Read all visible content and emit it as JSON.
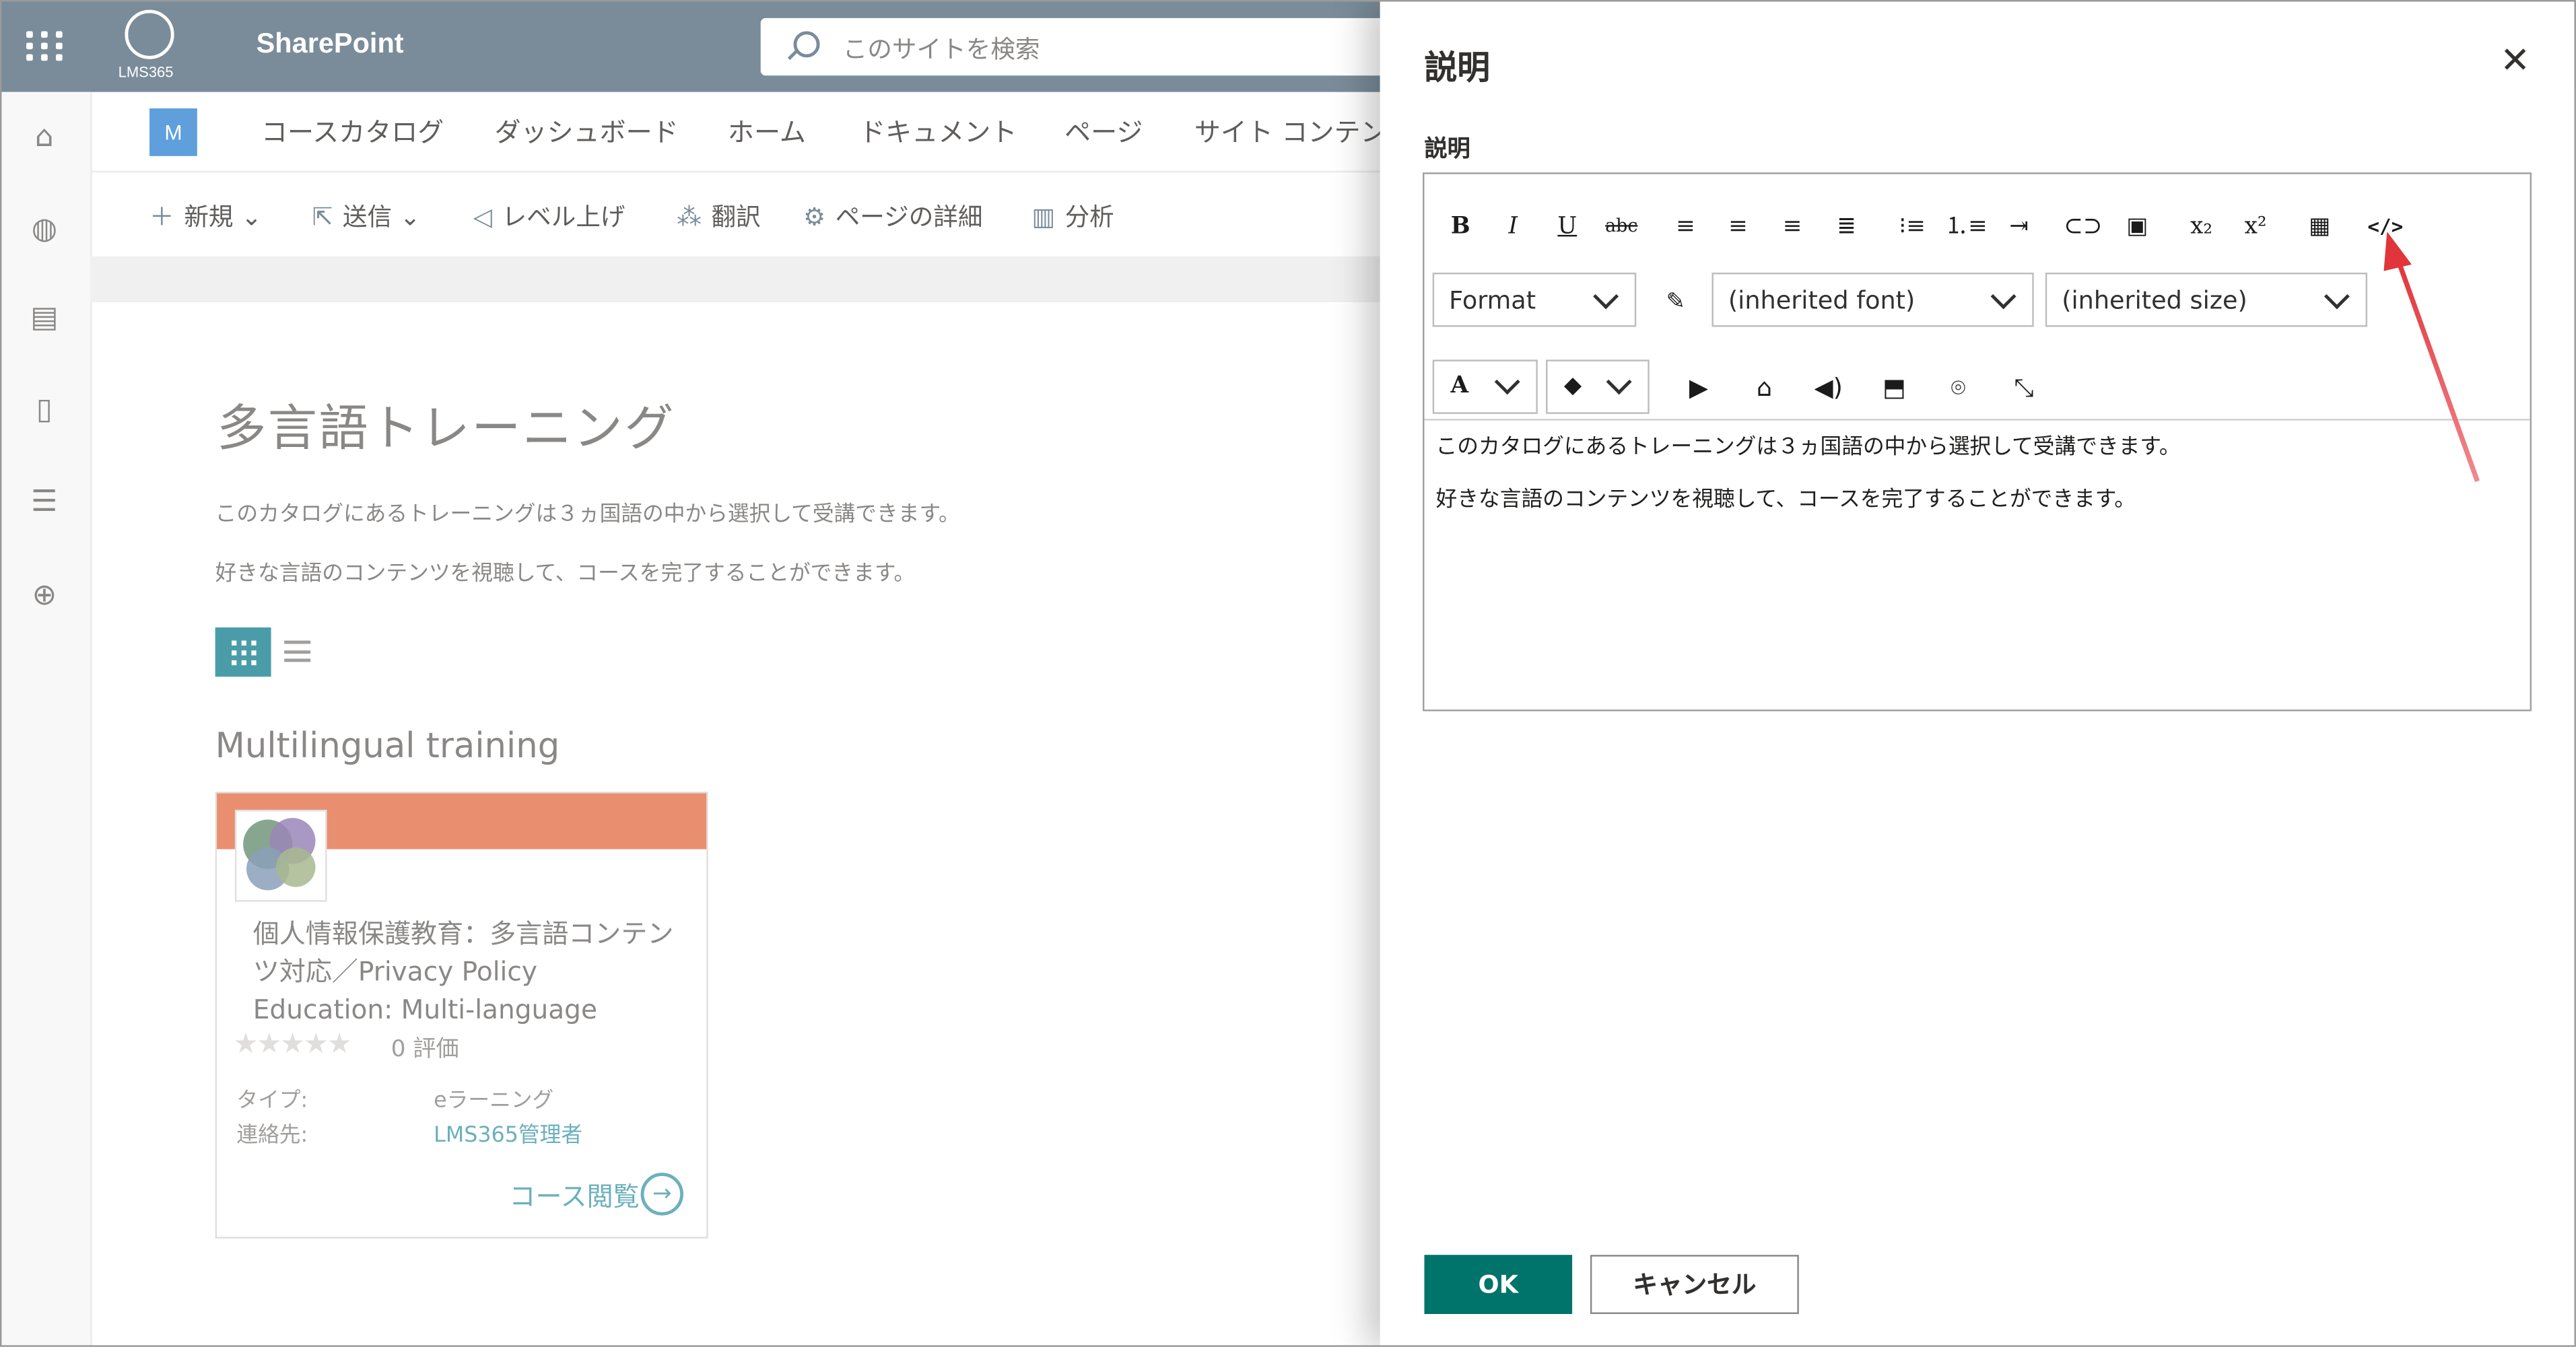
{
  "suite": {
    "app_title": "SharePoint",
    "logo_label": "LMS365",
    "search_placeholder": "このサイトを検索"
  },
  "rail": {
    "icons": [
      "home-icon",
      "globe-icon",
      "news-icon",
      "file-icon",
      "list-icon",
      "add-icon"
    ]
  },
  "nav": {
    "site_badge": "M",
    "items": [
      "コースカタログ",
      "ダッシュボード",
      "ホーム",
      "ドキュメント",
      "ページ",
      "サイト コンテン"
    ]
  },
  "commands": {
    "new": "新規",
    "send": "送信",
    "promote": "レベル上げ",
    "translate": "翻訳",
    "page_details": "ページの詳細",
    "analytics": "分析"
  },
  "page": {
    "title": "多言語トレーニング",
    "desc1": "このカタログにあるトレーニングは３ヵ国語の中から選択して受講できます。",
    "desc2": "好きな言語のコンテンツを視聴して、コースを完了することができます。",
    "section_title": "Multilingual training"
  },
  "card": {
    "title": "個人情報保護教育：多言語コンテンツ対応／Privacy Policy Education: Multi-language",
    "rating_value": 0,
    "rating_text": "0 評価",
    "type_label": "タイプ:",
    "type_value": "eラーニング",
    "contact_label": "連絡先:",
    "contact_value": "LMS365管理者",
    "course_link": "コース閲覧",
    "accent_color": "#e98f70"
  },
  "panel": {
    "title": "説明",
    "field_label": "説明",
    "toolbar": {
      "format_select": "Format",
      "font_select": "(inherited font)",
      "size_select": "(inherited size)"
    },
    "editor_text": [
      "このカタログにあるトレーニングは３ヵ国語の中から選択して受講できます。",
      "好きな言語のコンテンツを視聴して、コースを完了することができます。"
    ],
    "ok_label": "OK",
    "cancel_label": "キャンセル",
    "accent_color": "#00736b",
    "annotation_arrow_color": "#e0353a"
  }
}
